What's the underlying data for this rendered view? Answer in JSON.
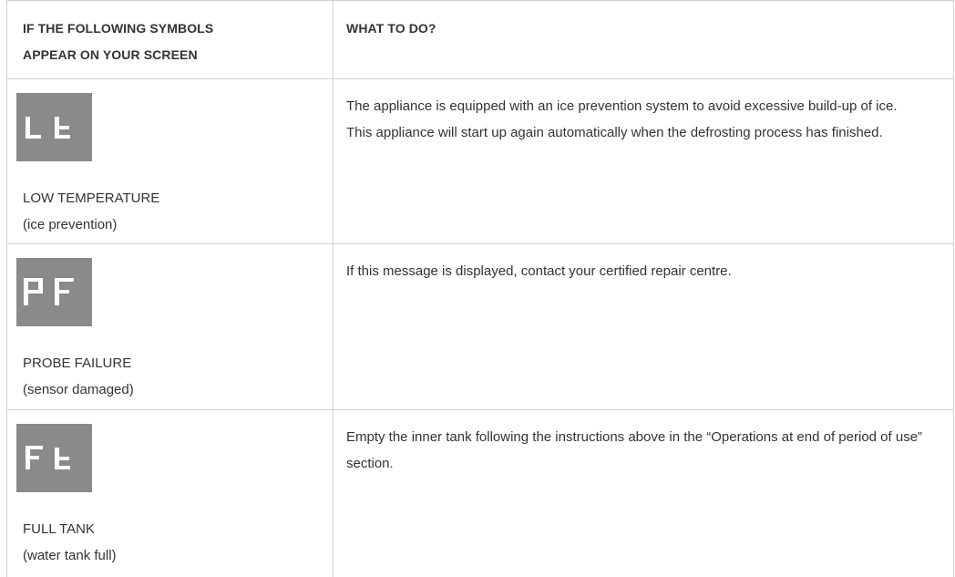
{
  "table": {
    "header": {
      "col1": [
        "IF THE FOLLOWING SYMBOLS",
        "APPEAR ON YOUR SCREEN"
      ],
      "col2": "WHAT TO DO?"
    },
    "rows": [
      {
        "symbol": "Lt",
        "symbol_icon": "lcd-lt-icon",
        "label_line1": "LOW TEMPERATURE",
        "label_line2": "(ice prevention)",
        "desc": [
          "The appliance is equipped with an ice prevention system to avoid excessive build-up of ice.",
          "This appliance will start up again automatically when the defrosting process has finished."
        ]
      },
      {
        "symbol": "PF",
        "symbol_icon": "lcd-pf-icon",
        "label_line1": "PROBE FAILURE",
        "label_line2": "(sensor damaged)",
        "desc": [
          "If this message is displayed, contact your certified repair centre."
        ]
      },
      {
        "symbol": "Ft",
        "symbol_icon": "lcd-ft-icon",
        "label_line1": "FULL TANK",
        "label_line2": "(water tank full)",
        "desc": [
          "Empty the inner tank following the instructions above in the “Operations at end of period of use” section."
        ]
      }
    ]
  },
  "colors": {
    "border": "#d0d0d0",
    "lcd_background": "#8a8a8a",
    "lcd_segment": "#ffffff",
    "text": "#333333"
  }
}
